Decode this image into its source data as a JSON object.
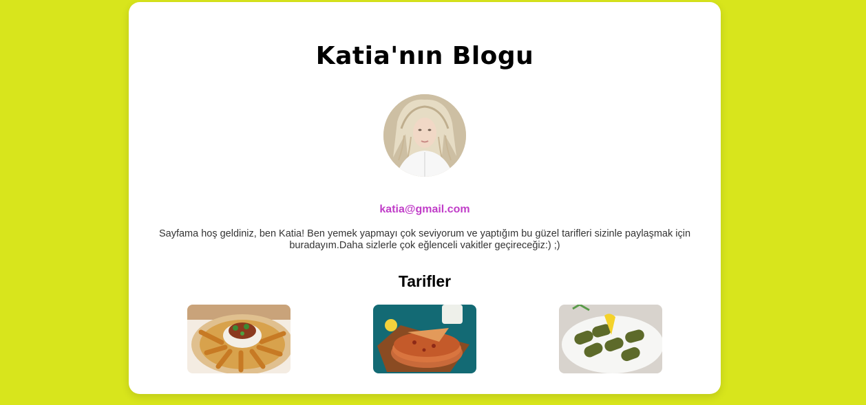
{
  "blog": {
    "title": "Katia'nın Blogu",
    "avatar_icon": "profile-photo",
    "email": "katia@gmail.com",
    "intro": "Sayfama hoş geldiniz, ben Katia! Ben yemek yapmayı çok seviyorum ve yaptığım bu güzel tarifleri sizinle paylaşmak için buradayım.Daha sizlerle çok eğlenceli vakitler geçireceğiz:) ;)"
  },
  "recipes": {
    "title": "Tarifler",
    "items": [
      {
        "image": "sigara-boregi-photo"
      },
      {
        "image": "lahmacun-photo"
      },
      {
        "image": "sarma-photo"
      }
    ]
  },
  "colors": {
    "page_background": "#d8e51c",
    "card_background": "#ffffff",
    "email": "#c03dc8"
  }
}
